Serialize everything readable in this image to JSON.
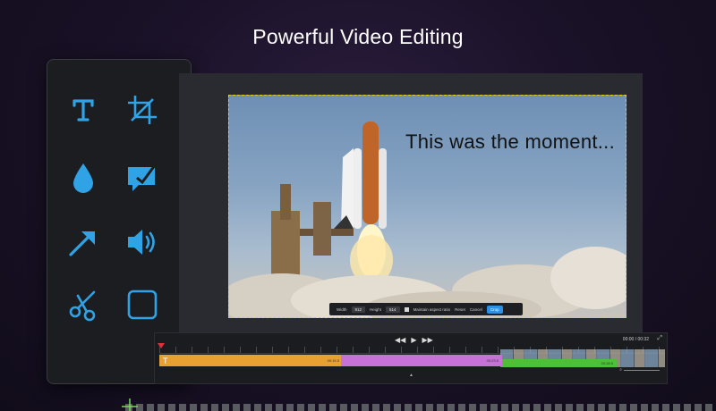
{
  "headline": "Powerful Video Editing",
  "colors": {
    "accent": "#2fa3e6",
    "selection": "#e8d000",
    "text_track": "#e8a033",
    "purple_track": "#c672d6",
    "green_track": "#4fbf3a",
    "playhead": "#e0303a"
  },
  "tools": [
    {
      "name": "text-tool",
      "icon": "text-icon"
    },
    {
      "name": "crop-tool",
      "icon": "crop-icon"
    },
    {
      "name": "color-tool",
      "icon": "droplet-icon"
    },
    {
      "name": "annotate-tool",
      "icon": "callout-icon"
    },
    {
      "name": "arrow-tool",
      "icon": "arrow-icon"
    },
    {
      "name": "audio-tool",
      "icon": "speaker-icon"
    },
    {
      "name": "cut-tool",
      "icon": "scissors-icon"
    },
    {
      "name": "shape-tool",
      "icon": "rectangle-icon"
    }
  ],
  "canvas": {
    "overlay_text": "This was the moment..."
  },
  "crop_bar": {
    "width_label": "Width",
    "width_value": "912",
    "height_label": "Height",
    "height_value": "514",
    "aspect_label": "Maintain aspect ratio",
    "reset_label": "Reset",
    "cancel_label": "Cancel",
    "crop_label": "Crop"
  },
  "timeline": {
    "timecode": "00:00 / 00:32",
    "rewind_icon": "rewind-icon",
    "play_icon": "play-icon",
    "forward_icon": "fast-forward-icon",
    "text_track_label": "T",
    "text_track_time": "00:15.5",
    "purple_track_time": "00:23.5",
    "green_track_time": "00:28.5"
  }
}
